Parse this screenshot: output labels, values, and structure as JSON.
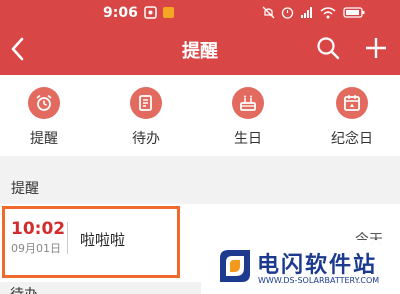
{
  "statusbar": {
    "time": "9:06"
  },
  "header": {
    "title": "提醒"
  },
  "shortcuts": [
    {
      "label": "提醒",
      "icon": "alarm-clock-icon"
    },
    {
      "label": "待办",
      "icon": "todo-list-icon"
    },
    {
      "label": "生日",
      "icon": "birthday-cake-icon"
    },
    {
      "label": "纪念日",
      "icon": "calendar-icon"
    }
  ],
  "section": {
    "title": "提醒",
    "next_title": "待办"
  },
  "reminder": {
    "time": "10:02",
    "date": "09月01日",
    "title": "啦啦啦",
    "day": "今天"
  },
  "watermark": {
    "title": "电闪软件站",
    "sub": "WWW.DS-SOLARBATTERY.COM"
  },
  "colors": {
    "header": "#d94646",
    "accent": "#e26a5e",
    "time": "#d22c2c",
    "highlight": "#f06a2e"
  }
}
